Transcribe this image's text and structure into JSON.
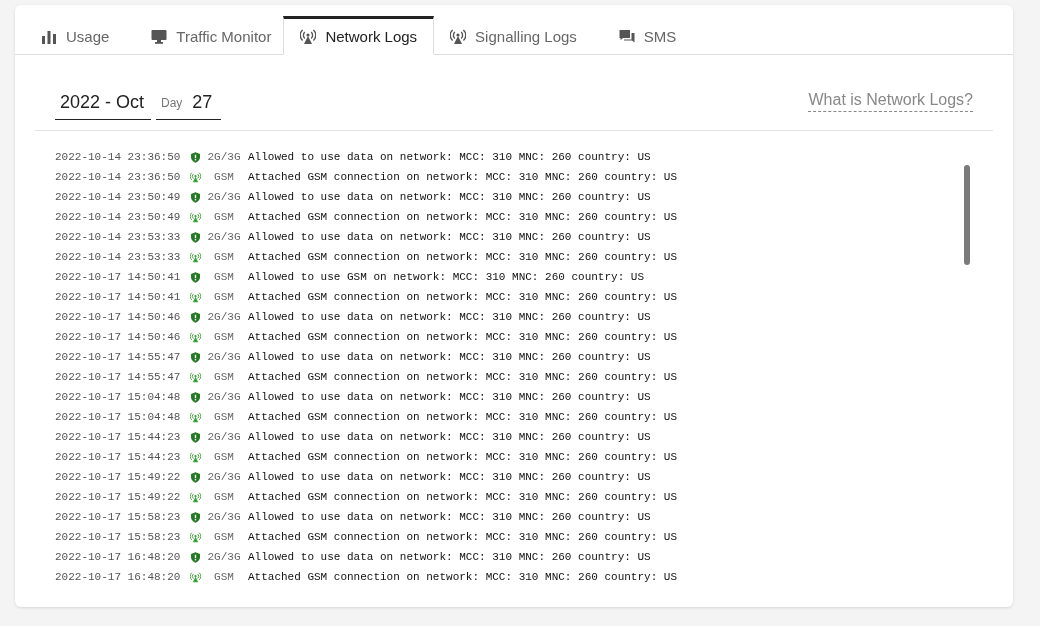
{
  "tabs": [
    {
      "label": "Usage",
      "kind": "bars",
      "selected": false
    },
    {
      "label": "Traffic Monitor",
      "kind": "monitor",
      "selected": false
    },
    {
      "label": "Network Logs",
      "kind": "antenna",
      "selected": true
    },
    {
      "label": "Signalling Logs",
      "kind": "antenna",
      "selected": false
    },
    {
      "label": "SMS",
      "kind": "chat",
      "selected": false
    }
  ],
  "month_field": {
    "value": "2022 - Oct"
  },
  "day_field": {
    "label": "Day",
    "value": "27"
  },
  "help_link": "What is Network Logs?",
  "log_rows": [
    {
      "time": "2022-10-14 23:36:50",
      "kind": "shield",
      "network": "2G/3G",
      "message": "Allowed to use data on network: MCC: 310 MNC: 260 country: US"
    },
    {
      "time": "2022-10-14 23:36:50",
      "kind": "antenna",
      "network": "GSM",
      "message": "Attached GSM connection on network: MCC: 310 MNC: 260 country: US"
    },
    {
      "time": "2022-10-14 23:50:49",
      "kind": "shield",
      "network": "2G/3G",
      "message": "Allowed to use data on network: MCC: 310 MNC: 260 country: US"
    },
    {
      "time": "2022-10-14 23:50:49",
      "kind": "antenna",
      "network": "GSM",
      "message": "Attached GSM connection on network: MCC: 310 MNC: 260 country: US"
    },
    {
      "time": "2022-10-14 23:53:33",
      "kind": "shield",
      "network": "2G/3G",
      "message": "Allowed to use data on network: MCC: 310 MNC: 260 country: US"
    },
    {
      "time": "2022-10-14 23:53:33",
      "kind": "antenna",
      "network": "GSM",
      "message": "Attached GSM connection on network: MCC: 310 MNC: 260 country: US"
    },
    {
      "time": "2022-10-17 14:50:41",
      "kind": "shield",
      "network": "GSM",
      "message": "Allowed to use GSM on network: MCC: 310 MNC: 260 country: US"
    },
    {
      "time": "2022-10-17 14:50:41",
      "kind": "antenna",
      "network": "GSM",
      "message": "Attached GSM connection on network: MCC: 310 MNC: 260 country: US"
    },
    {
      "time": "2022-10-17 14:50:46",
      "kind": "shield",
      "network": "2G/3G",
      "message": "Allowed to use data on network: MCC: 310 MNC: 260 country: US"
    },
    {
      "time": "2022-10-17 14:50:46",
      "kind": "antenna",
      "network": "GSM",
      "message": "Attached GSM connection on network: MCC: 310 MNC: 260 country: US"
    },
    {
      "time": "2022-10-17 14:55:47",
      "kind": "shield",
      "network": "2G/3G",
      "message": "Allowed to use data on network: MCC: 310 MNC: 260 country: US"
    },
    {
      "time": "2022-10-17 14:55:47",
      "kind": "antenna",
      "network": "GSM",
      "message": "Attached GSM connection on network: MCC: 310 MNC: 260 country: US"
    },
    {
      "time": "2022-10-17 15:04:48",
      "kind": "shield",
      "network": "2G/3G",
      "message": "Allowed to use data on network: MCC: 310 MNC: 260 country: US"
    },
    {
      "time": "2022-10-17 15:04:48",
      "kind": "antenna",
      "network": "GSM",
      "message": "Attached GSM connection on network: MCC: 310 MNC: 260 country: US"
    },
    {
      "time": "2022-10-17 15:44:23",
      "kind": "shield",
      "network": "2G/3G",
      "message": "Allowed to use data on network: MCC: 310 MNC: 260 country: US"
    },
    {
      "time": "2022-10-17 15:44:23",
      "kind": "antenna",
      "network": "GSM",
      "message": "Attached GSM connection on network: MCC: 310 MNC: 260 country: US"
    },
    {
      "time": "2022-10-17 15:49:22",
      "kind": "shield",
      "network": "2G/3G",
      "message": "Allowed to use data on network: MCC: 310 MNC: 260 country: US"
    },
    {
      "time": "2022-10-17 15:49:22",
      "kind": "antenna",
      "network": "GSM",
      "message": "Attached GSM connection on network: MCC: 310 MNC: 260 country: US"
    },
    {
      "time": "2022-10-17 15:58:23",
      "kind": "shield",
      "network": "2G/3G",
      "message": "Allowed to use data on network: MCC: 310 MNC: 260 country: US"
    },
    {
      "time": "2022-10-17 15:58:23",
      "kind": "antenna",
      "network": "GSM",
      "message": "Attached GSM connection on network: MCC: 310 MNC: 260 country: US"
    },
    {
      "time": "2022-10-17 16:48:20",
      "kind": "shield",
      "network": "2G/3G",
      "message": "Allowed to use data on network: MCC: 310 MNC: 260 country: US"
    },
    {
      "time": "2022-10-17 16:48:20",
      "kind": "antenna",
      "network": "GSM",
      "message": "Attached GSM connection on network: MCC: 310 MNC: 260 country: US"
    }
  ]
}
